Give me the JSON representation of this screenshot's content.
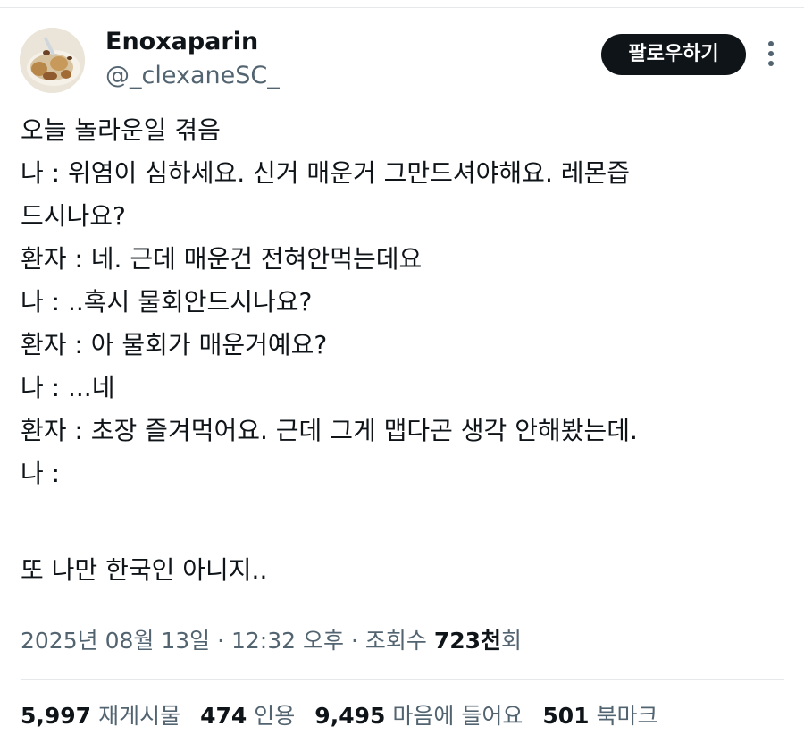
{
  "author": {
    "display_name": "Enoxaparin",
    "handle": "@_clexaneSC_",
    "avatar_icon": "food-plate-avatar"
  },
  "follow_button_label": "팔로우하기",
  "more_icon": "more-vertical-icon",
  "tweet_lines": [
    "오늘 놀라운일 겪음",
    "나 : 위염이 심하세요. 신거 매운거 그만드셔야해요. 레몬즙",
    "드시나요?",
    "환자 : 네. 근데 매운건 전혀안먹는데요",
    "나 : ..혹시 물회안드시나요?",
    "환자 : 아 물회가 매운거예요?",
    "나 : ...네",
    "환자 : 초장 즐겨먹어요. 근데 그게 맵다곤 생각 안해봤는데.",
    "나 :",
    "",
    "또 나만 한국인 아니지.."
  ],
  "meta": {
    "date": "2025년 08월 13일",
    "separator": "·",
    "time": "12:32 오후",
    "views_label": "조회수",
    "views_count": "723천",
    "views_suffix": "회"
  },
  "stats": {
    "reposts": {
      "count": "5,997",
      "label": "재게시물"
    },
    "quotes": {
      "count": "474",
      "label": "인용"
    },
    "likes": {
      "count": "9,495",
      "label": "마음에 들어요"
    },
    "bookmarks": {
      "count": "501",
      "label": "북마크"
    }
  },
  "colors": {
    "text_primary": "#0f1419",
    "text_secondary": "#536471",
    "divider": "#e6e9eb",
    "button_bg": "#0f1419",
    "button_text": "#ffffff"
  }
}
